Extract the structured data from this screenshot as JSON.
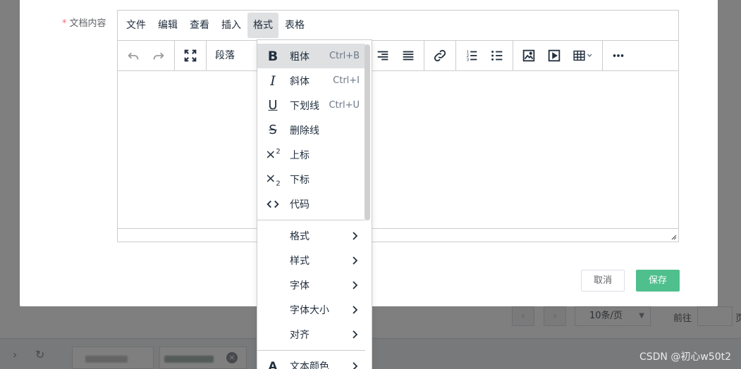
{
  "dialog": {
    "field_label": "文档内容",
    "required_mark": "*",
    "cancel_label": "取消",
    "save_label": "保存"
  },
  "editor": {
    "menubar": [
      {
        "label": "文件"
      },
      {
        "label": "编辑"
      },
      {
        "label": "查看"
      },
      {
        "label": "插入"
      },
      {
        "label": "格式",
        "active": true
      },
      {
        "label": "表格"
      }
    ],
    "toolbar": {
      "block_format": "段落",
      "icons": [
        "undo-icon",
        "redo-icon",
        "fullscreen-icon",
        "align-right-icon",
        "align-justify-icon",
        "link-icon",
        "numbered-list-icon",
        "bullet-list-icon",
        "image-icon",
        "media-icon",
        "table-icon",
        "more-icon"
      ]
    }
  },
  "format_menu": {
    "items": [
      {
        "label": "粗体",
        "shortcut": "Ctrl+B",
        "icon": "bold-icon"
      },
      {
        "label": "斜体",
        "shortcut": "Ctrl+I",
        "icon": "italic-icon"
      },
      {
        "label": "下划线",
        "shortcut": "Ctrl+U",
        "icon": "underline-icon"
      },
      {
        "label": "删除线",
        "shortcut": "",
        "icon": "strikethrough-icon"
      },
      {
        "label": "上标",
        "shortcut": "",
        "icon": "superscript-icon"
      },
      {
        "label": "下标",
        "shortcut": "",
        "icon": "subscript-icon"
      },
      {
        "label": "代码",
        "shortcut": "",
        "icon": "code-icon"
      }
    ],
    "submenus": [
      {
        "label": "格式"
      },
      {
        "label": "样式"
      },
      {
        "label": "字体"
      },
      {
        "label": "字体大小"
      },
      {
        "label": "对齐"
      },
      {
        "label": "文本颜色"
      }
    ]
  },
  "pager": {
    "page_size": "10条/页",
    "goto_label": "前往",
    "suffix": "页"
  },
  "watermark": "CSDN @初心w50t2",
  "colors": {
    "accent": "#4fc08d",
    "required": "#f56c6c",
    "menu_active": "#dee0e2"
  }
}
